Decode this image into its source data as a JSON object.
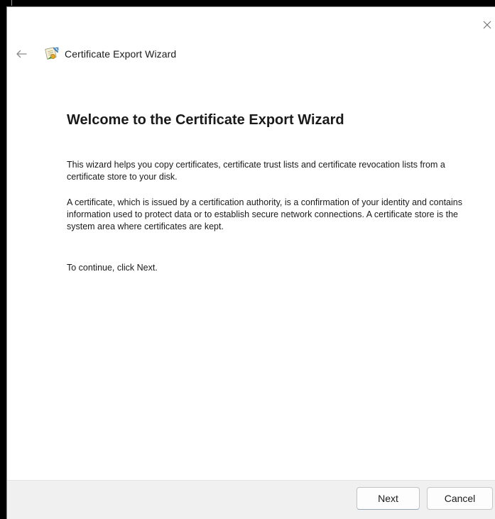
{
  "window": {
    "title": "Certificate Export Wizard",
    "close_icon": "close-icon",
    "back_icon": "back-arrow-icon",
    "app_icon": "certificate-icon"
  },
  "content": {
    "heading": "Welcome to the Certificate Export Wizard",
    "paragraph1": "This wizard helps you copy certificates, certificate trust lists and certificate revocation lists from a certificate store to your disk.",
    "paragraph2": "A certificate, which is issued by a certification authority, is a confirmation of your identity and contains information used to protect data or to establish secure network connections. A certificate store is the system area where certificates are kept.",
    "paragraph3": "To continue, click Next."
  },
  "footer": {
    "next_label": "Next",
    "cancel_label": "Cancel"
  },
  "colors": {
    "outer_frame": "#000000",
    "window_bg": "#ffffff",
    "footer_bg": "#f0f0f0",
    "text": "#1a1a1a"
  }
}
